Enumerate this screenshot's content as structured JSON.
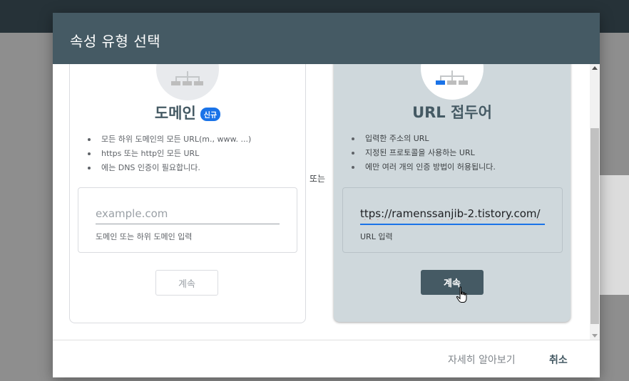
{
  "dialog": {
    "title": "속성 유형 선택",
    "or_label": "또는"
  },
  "domain": {
    "title": "도메인",
    "badge": "신규",
    "bullets": [
      "모든 하위 도메인의 모든 URL(m., www. ...)",
      "https 또는 http인 모든 URL",
      "에는 DNS 인증이 필요합니다."
    ],
    "input_placeholder": "example.com",
    "input_helper": "도메인 또는 하위 도메인 입력",
    "continue_label": "계속"
  },
  "url_prefix": {
    "title": "URL 접두어",
    "bullets": [
      "입력한 주소의 URL",
      "지정된 프로토콜을 사용하는 URL",
      "에만 여러 개의 인증 방법이 허용됩니다."
    ],
    "input_value": "ttps://ramenssanjib-2.tistory.com/",
    "input_helper": "URL 입력",
    "continue_label": "계속"
  },
  "footer": {
    "learn_more": "자세히 알아보기",
    "cancel": "취소"
  },
  "colors": {
    "header": "#455a64",
    "accent": "#1a73e8",
    "selected_card": "#cfd8dc",
    "primary_button": "#455a64"
  }
}
